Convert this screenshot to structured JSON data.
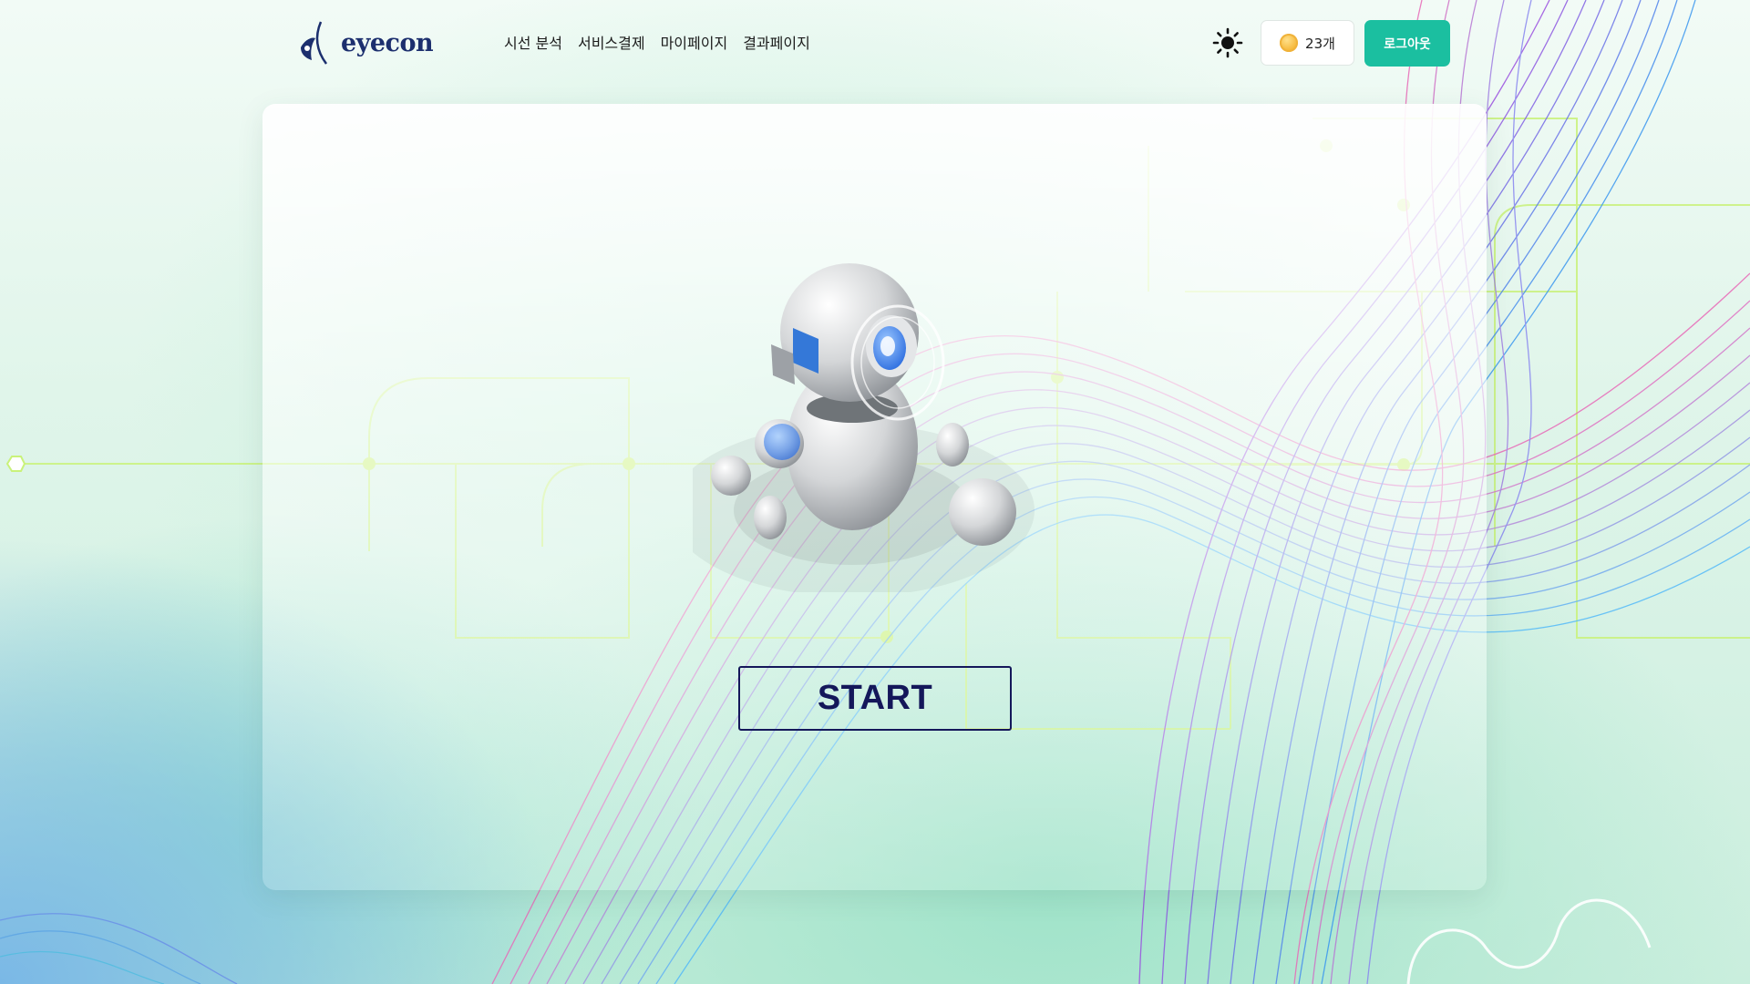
{
  "brand": {
    "name": "eyecon",
    "color": "#1c2f6e"
  },
  "nav": {
    "items": [
      {
        "label": "시선 분석"
      },
      {
        "label": "서비스결제"
      },
      {
        "label": "마이페이지"
      },
      {
        "label": "결과페이지"
      }
    ]
  },
  "header": {
    "theme_icon": "sun-icon",
    "coin": {
      "icon": "coin-icon",
      "label": "23개"
    },
    "logout_label": "로그아웃",
    "accent_color": "#1bbfa0"
  },
  "main": {
    "illustration": "robot-illustration",
    "start_label": "START",
    "start_color": "#14175a"
  }
}
